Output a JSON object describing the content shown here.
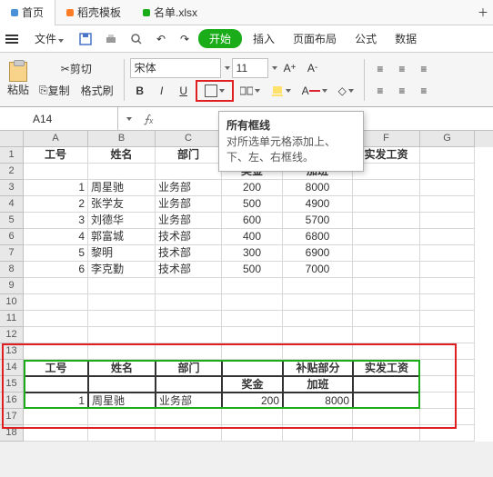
{
  "tabs": [
    {
      "label": "首页",
      "color": "blue",
      "active": true
    },
    {
      "label": "稻壳模板",
      "color": "orange",
      "active": false
    },
    {
      "label": "名单.xlsx",
      "color": "green",
      "active": false
    }
  ],
  "menubar": {
    "file": "文件",
    "start": "开始",
    "insert": "插入",
    "layout": "页面布局",
    "formula": "公式",
    "data": "数据"
  },
  "toolbar": {
    "paste": "粘贴",
    "cut": "剪切",
    "copy": "复制",
    "format_painter": "格式刷",
    "font": "宋体",
    "size": "11",
    "bold": "B",
    "italic": "I",
    "underline": "U"
  },
  "tooltip": {
    "title": "所有框线",
    "body": "对所选单元格添加上、下、左、右框线。"
  },
  "namebox": "A14",
  "fx": "fx",
  "columns": [
    "A",
    "B",
    "C",
    "D",
    "E",
    "F",
    "G"
  ],
  "headers": {
    "id": "工号",
    "name": "姓名",
    "dept": "部门",
    "subsidy": "补贴部分",
    "bonus": "奖金",
    "overtime": "加班",
    "net": "实发工资"
  },
  "data": [
    {
      "id": "1",
      "name": "周星驰",
      "dept": "业务部",
      "bonus": "200",
      "ot": "8000"
    },
    {
      "id": "2",
      "name": "张学友",
      "dept": "业务部",
      "bonus": "500",
      "ot": "4900"
    },
    {
      "id": "3",
      "name": "刘德华",
      "dept": "业务部",
      "bonus": "600",
      "ot": "5700"
    },
    {
      "id": "4",
      "name": "郭富城",
      "dept": "技术部",
      "bonus": "400",
      "ot": "6800"
    },
    {
      "id": "5",
      "name": "黎明",
      "dept": "技术部",
      "bonus": "300",
      "ot": "6900"
    },
    {
      "id": "6",
      "name": "李克勤",
      "dept": "技术部",
      "bonus": "500",
      "ot": "7000"
    }
  ],
  "lower": {
    "id": "1",
    "name": "周星驰",
    "dept": "业务部",
    "bonus": "200",
    "ot": "8000"
  }
}
